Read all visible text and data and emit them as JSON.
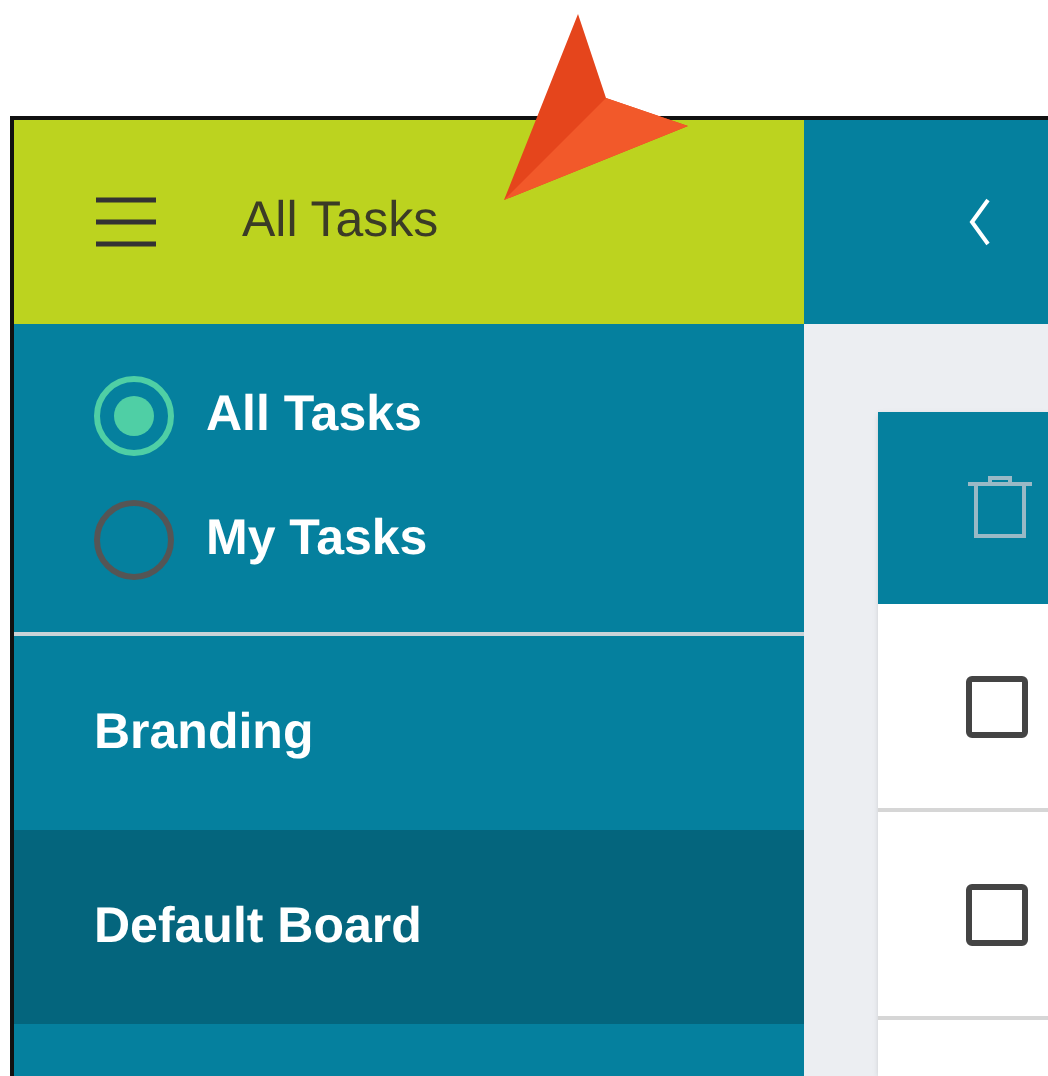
{
  "header": {
    "title": "All Tasks"
  },
  "filters": [
    {
      "label": "All Tasks",
      "selected": true
    },
    {
      "label": "My Tasks",
      "selected": false
    }
  ],
  "boards": [
    {
      "label": "Branding",
      "selected": false
    },
    {
      "label": "Default Board",
      "selected": true
    }
  ],
  "task_rows": [
    {
      "checked": false
    },
    {
      "checked": false
    }
  ]
}
